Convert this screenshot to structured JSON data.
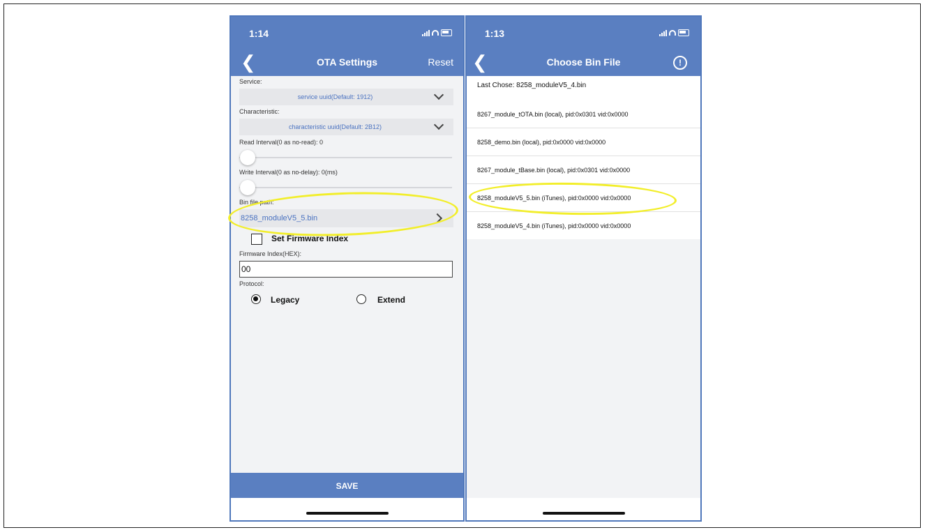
{
  "left_phone": {
    "status_time": "1:14",
    "title": "OTA Settings",
    "back_icon": "chevron-left-icon",
    "reset_label": "Reset",
    "service_label": "Service:",
    "service_value": "service uuid(Default: 1912)",
    "characteristic_label": "Characteristic:",
    "characteristic_value": "characteristic uuid(Default: 2B12)",
    "read_interval_label": "Read Interval(0 as no-read): 0",
    "read_interval_value": 0,
    "write_interval_label": "Write Interval(0 as no-delay): 0(ms)",
    "write_interval_value": 0,
    "bin_path_label": "Bin file path:",
    "bin_path_value": "8258_moduleV5_5.bin",
    "set_firmware_index_label": "Set Firmware Index",
    "set_firmware_index_checked": false,
    "firmware_index_label": "Firmware Index(HEX):",
    "firmware_index_value": "00",
    "protocol_label": "Protocol:",
    "protocol_options": [
      "Legacy",
      "Extend"
    ],
    "protocol_selected": "Legacy",
    "save_label": "SAVE"
  },
  "right_phone": {
    "status_time": "1:13",
    "title": "Choose Bin File",
    "back_icon": "chevron-left-icon",
    "info_icon": "exclamation-circle-icon",
    "last_chose": "Last Chose: 8258_moduleV5_4.bin",
    "files": [
      "8267_module_tOTA.bin (local), pid:0x0301 vid:0x0000",
      "8258_demo.bin (local), pid:0x0000 vid:0x0000",
      "8267_module_tBase.bin (local), pid:0x0301 vid:0x0000",
      "8258_moduleV5_5.bin (iTunes), pid:0x0000 vid:0x0000",
      "8258_moduleV5_4.bin (iTunes), pid:0x0000 vid:0x0000"
    ]
  },
  "colors": {
    "header": "#5a7fc1",
    "accent_text": "#4a72c0",
    "highlight": "#f2ee2a"
  }
}
